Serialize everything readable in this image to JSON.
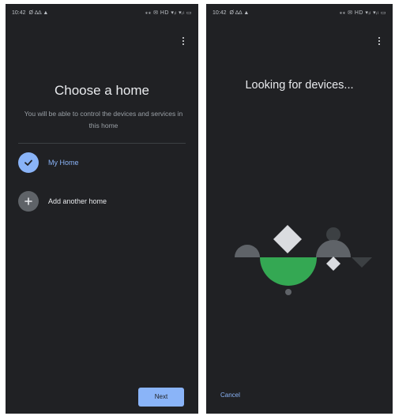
{
  "left_screen": {
    "status": {
      "time": "10:42",
      "left_icons": "Ø ∆∆ ▲",
      "right_icons": "⁎⁎ ✉ HD ▾ᵢₗ ▾ᵢₗ ▭"
    },
    "title": "Choose a home",
    "subtitle": "You will be able to control the devices and services in this home",
    "options": [
      {
        "label": "My Home",
        "selected": true,
        "icon": "check-icon"
      },
      {
        "label": "Add another home",
        "selected": false,
        "icon": "plus-icon"
      }
    ],
    "next_label": "Next"
  },
  "right_screen": {
    "status": {
      "time": "10:42",
      "left_icons": "Ø ∆∆ ▲",
      "right_icons": "⁎⁎ ✉ HD ▾ᵢₗ ▾ᵢₗ ▭"
    },
    "title": "Looking for devices...",
    "cancel_label": "Cancel"
  },
  "colors": {
    "background": "#202124",
    "accent_blue": "#8ab4f8",
    "green": "#34a853",
    "gray": "#5f6368",
    "light_gray": "#dadce0"
  }
}
